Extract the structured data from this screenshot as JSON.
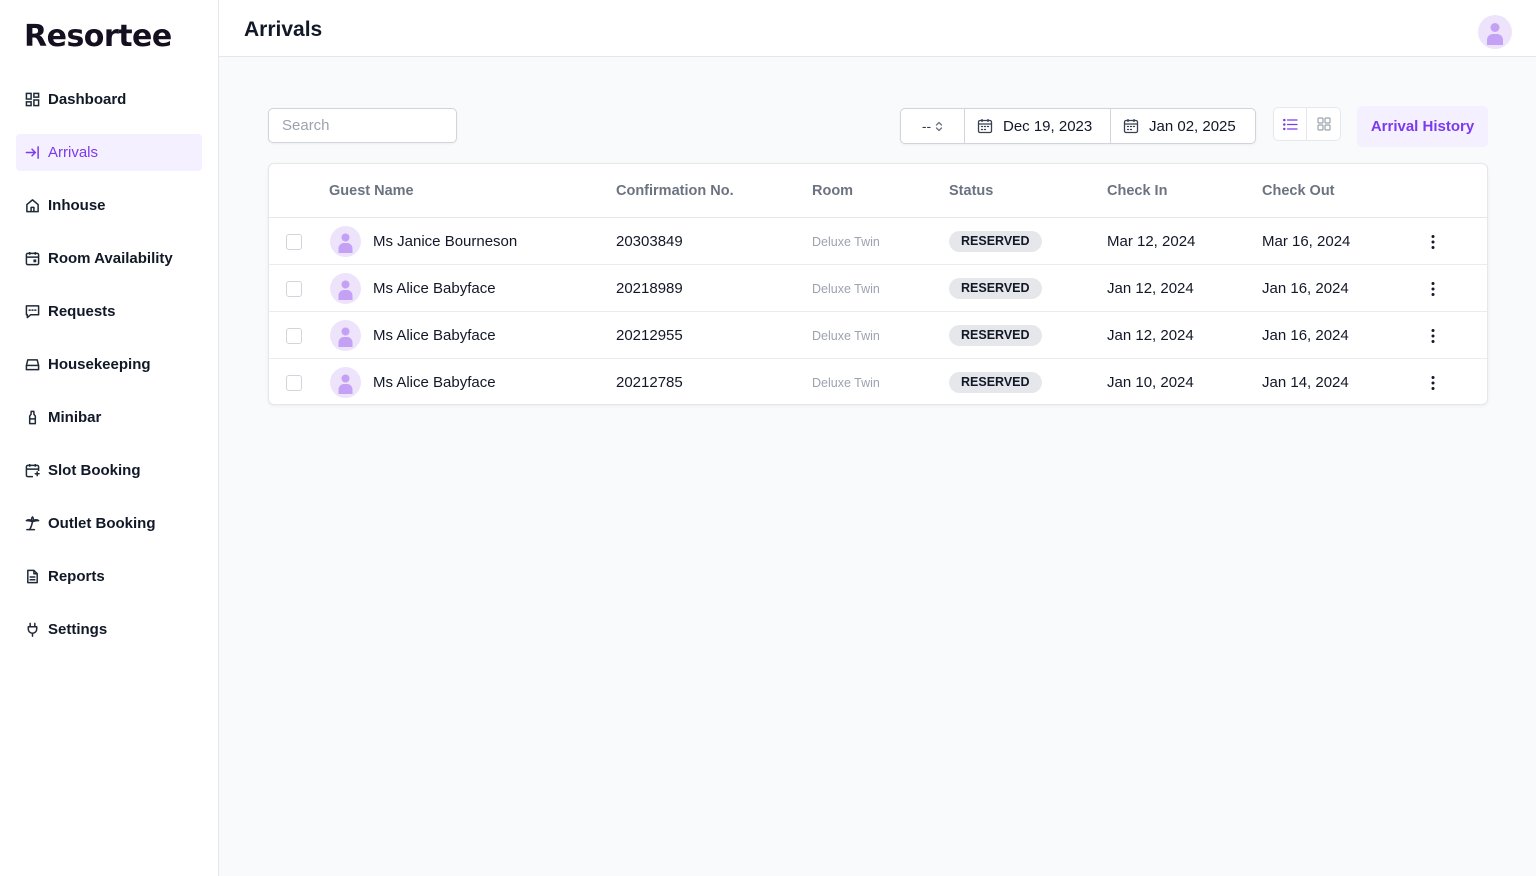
{
  "brand": {
    "name": "Resortee",
    "accent": "#7c3aed"
  },
  "sidebar": {
    "items": [
      {
        "label": "Dashboard",
        "icon": "dashboard-icon",
        "active": false
      },
      {
        "label": "Arrivals",
        "icon": "arrival-icon",
        "active": true
      },
      {
        "label": "Inhouse",
        "icon": "home-icon",
        "active": false
      },
      {
        "label": "Room Availability",
        "icon": "calendar-icon",
        "active": false
      },
      {
        "label": "Requests",
        "icon": "message-icon",
        "active": false
      },
      {
        "label": "Housekeeping",
        "icon": "tray-icon",
        "active": false
      },
      {
        "label": "Minibar",
        "icon": "bottle-icon",
        "active": false
      },
      {
        "label": "Slot Booking",
        "icon": "calendar-slot-icon",
        "active": false
      },
      {
        "label": "Outlet Booking",
        "icon": "palm-tree-icon",
        "active": false
      },
      {
        "label": "Reports",
        "icon": "document-icon",
        "active": false
      },
      {
        "label": "Settings",
        "icon": "plug-icon",
        "active": false
      }
    ]
  },
  "header": {
    "title": "Arrivals"
  },
  "toolbar": {
    "search_placeholder": "Search",
    "preset_value": "--",
    "start_date": "Dec 19, 2023",
    "end_date": "Jan 02, 2025",
    "history_label": "Arrival History"
  },
  "table": {
    "columns": [
      "Guest Name",
      "Confirmation No.",
      "Room",
      "Status",
      "Check In",
      "Check Out"
    ],
    "rows": [
      {
        "guest": "Ms Janice Bourneson",
        "confirmation": "20303849",
        "room": "Deluxe Twin",
        "status": "RESERVED",
        "check_in": "Mar 12, 2024",
        "check_out": "Mar 16, 2024"
      },
      {
        "guest": "Ms Alice Babyface",
        "confirmation": "20218989",
        "room": "Deluxe Twin",
        "status": "RESERVED",
        "check_in": "Jan 12, 2024",
        "check_out": "Jan 16, 2024"
      },
      {
        "guest": "Ms Alice Babyface",
        "confirmation": "20212955",
        "room": "Deluxe Twin",
        "status": "RESERVED",
        "check_in": "Jan 12, 2024",
        "check_out": "Jan 16, 2024"
      },
      {
        "guest": "Ms Alice Babyface",
        "confirmation": "20212785",
        "room": "Deluxe Twin",
        "status": "RESERVED",
        "check_in": "Jan 10, 2024",
        "check_out": "Jan 14, 2024"
      }
    ]
  }
}
